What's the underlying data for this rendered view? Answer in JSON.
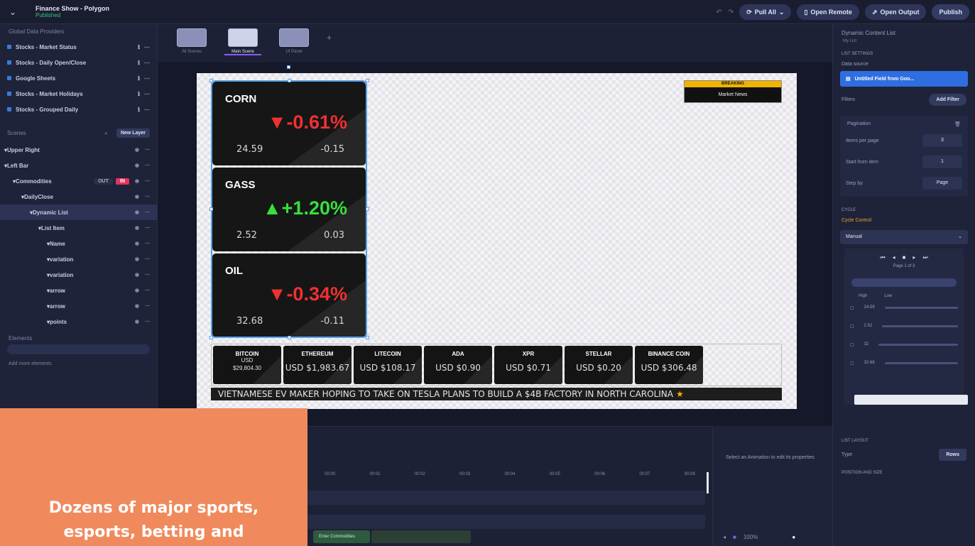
{
  "app": {
    "title": "Finance Show - Polygon",
    "subtitle": "Published",
    "buttons": {
      "pull": "Pull All",
      "remote": "Open Remote",
      "output": "Open Output",
      "publish": "Publish"
    }
  },
  "left": {
    "providers_title": "Global Data Providers",
    "providers": [
      {
        "label": "Stocks - Market Status"
      },
      {
        "label": "Stocks - Daily Open/Close"
      },
      {
        "label": "Google Sheets"
      },
      {
        "label": "Stocks - Market Holidays"
      },
      {
        "label": "Stocks - Grouped Daily"
      }
    ],
    "scenes_title": "Scenes",
    "new_button": "New Layer",
    "tree": [
      {
        "label": "Upper Right",
        "indent": 0
      },
      {
        "label": "Left Bar",
        "indent": 0
      },
      {
        "label": "Commodities",
        "indent": 1,
        "out": "OUT",
        "in": "IN"
      },
      {
        "label": "DailyClose",
        "indent": 2
      },
      {
        "label": "Dynamic List",
        "indent": 3,
        "selected": true
      },
      {
        "label": "List Item",
        "indent": 4
      },
      {
        "label": "Name",
        "indent": 5
      },
      {
        "label": "variation",
        "indent": 5
      },
      {
        "label": "variation",
        "indent": 5
      },
      {
        "label": "arrow",
        "indent": 5
      },
      {
        "label": "arrow",
        "indent": 5
      },
      {
        "label": "points",
        "indent": 5
      }
    ],
    "elements_title": "Elements",
    "add_chip": "Add more elements"
  },
  "promo": {
    "line1": "Dozens of major sports,",
    "line2": "esports, betting and"
  },
  "scenes": [
    {
      "name": "All Scenes",
      "active": false
    },
    {
      "name": "Main Scene",
      "active": true
    },
    {
      "name": "UI Panel",
      "active": false
    }
  ],
  "commodities": [
    {
      "name": "CORN",
      "change": "▼-0.61%",
      "direction": "down",
      "price": "24.59",
      "delta": "-0.15"
    },
    {
      "name": "GASS",
      "change": "▲+1.20%",
      "direction": "up",
      "price": "2.52",
      "delta": "0.03"
    },
    {
      "name": "OIL",
      "change": "▼-0.34%",
      "direction": "down",
      "price": "32.68",
      "delta": "-0.11"
    }
  ],
  "breaking": {
    "header": "BREAKING",
    "body": "Market News"
  },
  "crypto": [
    {
      "name": "BITCOIN",
      "unit": "USD",
      "value": "$29,804.30"
    },
    {
      "name": "ETHEREUM",
      "price": "USD $1,983.67"
    },
    {
      "name": "LITECOIN",
      "price": "USD $108.17"
    },
    {
      "name": "ADA",
      "price": "USD $0.90"
    },
    {
      "name": "XPR",
      "price": "USD $0.71"
    },
    {
      "name": "STELLAR",
      "price": "USD $0.20"
    },
    {
      "name": "BINANCE COIN",
      "price": "USD $306.48"
    }
  ],
  "ticker": {
    "text": "VIETNAMESE EV MAKER HOPING TO TAKE ON TESLA PLANS TO BUILD A $4B FACTORY IN NORTH CAROLINA",
    "star": "★"
  },
  "timeline": {
    "marks": [
      "00:00",
      "00:01",
      "00:02",
      "00:03",
      "00:04",
      "00:05",
      "00:06",
      "00:07",
      "00:08"
    ],
    "clip": "Enter Commodities"
  },
  "anim": {
    "hint": "Select an Animation to edit its properties",
    "zoom": "100%"
  },
  "right": {
    "title": "Dynamic Content List",
    "sub": "My List",
    "list_settings": "LIST SETTINGS",
    "data_source_label": "Data source",
    "data_source": "Untitled Field from Goo...",
    "filters_label": "Filters",
    "add_filter": "Add Filter",
    "pagination": "Pagination",
    "items_per_page_label": "Items per page",
    "items_per_page": "3",
    "start_from_label": "Start from item",
    "start_from": "1",
    "step_label": "Step by",
    "step": "Page",
    "cycle": "CYCLE",
    "cycle_control": "Cycle Control",
    "cycle_mode": "Manual",
    "pager": "Page 1 of 3",
    "col_high": "High",
    "col_low": "Low",
    "rows": [
      "24.59",
      "2.52",
      "32",
      "32.68"
    ],
    "list_layout": "LIST LAYOUT",
    "type_label": "Type",
    "type_value": "Rows",
    "position": "POSITION AND SIZE"
  }
}
